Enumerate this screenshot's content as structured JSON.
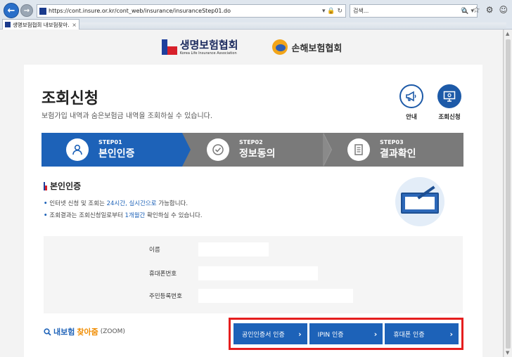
{
  "browser": {
    "back_glyph": "←",
    "forward_glyph": "→",
    "url": "https://cont.insure.or.kr/cont_web/insurance/insuranceStep01.do",
    "url_tools": "▾ 🔒 ↻",
    "search_placeholder": "검색...",
    "search_tools": "🔍 ▾",
    "icons": [
      "home-icon",
      "star-icon",
      "settings-icon",
      "smiley-icon"
    ],
    "icon_glyphs": {
      "home": "⌂",
      "star": "☆",
      "settings": "⚙",
      "smiley": "☺"
    },
    "tab_title": "생명보험협회 내보험찾아...",
    "tab_close": "×"
  },
  "header": {
    "life_logo": "생명보험협회",
    "life_logo_eng": "Korea Life Insurance Association",
    "nonlife_logo": "손해보험협회"
  },
  "main": {
    "title": "조회신청",
    "subtitle": "보험가입 내역과 숨은보험금 내역을 조회하실 수 있습니다.",
    "quick_links": [
      {
        "label": "안내",
        "icon": "megaphone-icon"
      },
      {
        "label": "조회신청",
        "icon": "monitor-icon"
      }
    ],
    "steps": [
      {
        "num": "STEP01",
        "label": "본인인증",
        "icon": "person-icon",
        "active": true
      },
      {
        "num": "STEP02",
        "label": "정보동의",
        "icon": "check-icon",
        "active": false
      },
      {
        "num": "STEP03",
        "label": "결과확인",
        "icon": "document-icon",
        "active": false
      }
    ],
    "section_title": "본인인증",
    "bullet1": {
      "pre": "인터넷 신청 및 조회는 ",
      "hl": "24시간, 실시간으로",
      "post": " 가능합니다."
    },
    "bullet2": {
      "pre": "조회결과는 조회신청일로부터 ",
      "hl": "1개월간",
      "post": " 확인하실 수 있습니다."
    },
    "form": {
      "name_label": "이름",
      "phone_label": "휴대폰번호",
      "rrn_label": "주민등록번호"
    },
    "zoom": {
      "pre": "내보험",
      "mid": "찾아줌",
      "post": "(ZOOM)"
    },
    "auth_buttons": [
      {
        "label": "공인인증서 인증"
      },
      {
        "label": "IPIN 인증"
      },
      {
        "label": "휴대폰 인증"
      }
    ],
    "chevron": "›"
  },
  "colors": {
    "primary": "#1d62b8",
    "step_inactive": "#7a7a7a",
    "highlight_border": "#e51e1e",
    "zoom_orange": "#f08c00"
  }
}
